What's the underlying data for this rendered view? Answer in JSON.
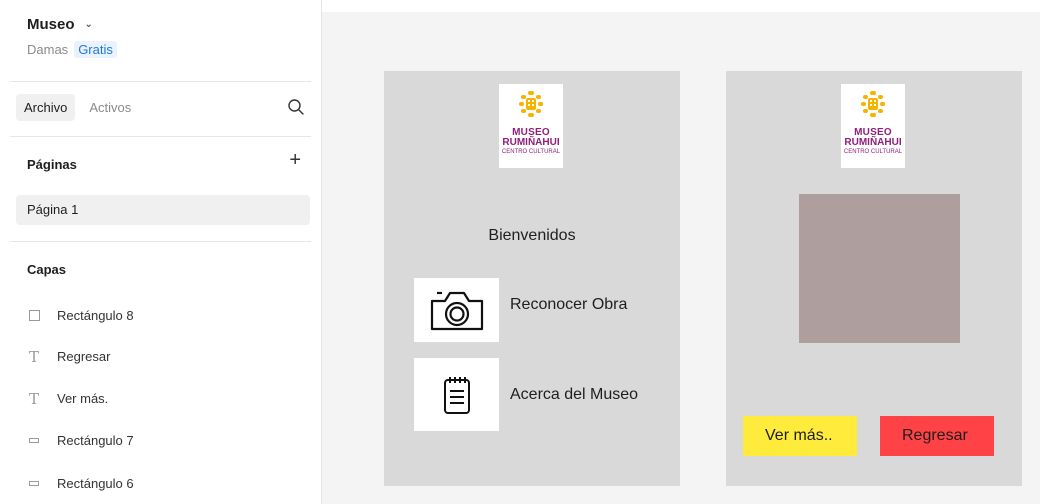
{
  "project": {
    "name": "Museo",
    "owner": "Damas",
    "plan": "Gratis"
  },
  "tabs": [
    {
      "label": "Archivo"
    },
    {
      "label": "Activos"
    }
  ],
  "pages": {
    "title": "Páginas",
    "items": [
      {
        "label": "Página 1"
      }
    ]
  },
  "layers": {
    "title": "Capas",
    "items": [
      {
        "label": "Rectángulo 8",
        "icon": "rectangle-icon"
      },
      {
        "label": "Regresar",
        "icon": "text-icon"
      },
      {
        "label": "Ver más.",
        "icon": "text-icon"
      },
      {
        "label": "Rectángulo 7",
        "icon": "rectangle-thin-icon"
      },
      {
        "label": "Rectángulo 6",
        "icon": "rectangle-thin-icon"
      }
    ]
  },
  "logo": {
    "line1": "MUSEO",
    "line2": "RUMIÑAHUI",
    "line3": "CENTRO CULTURAL"
  },
  "frame1": {
    "welcome": "Bienvenidos",
    "menu": [
      {
        "label": "Reconocer Obra",
        "icon": "camera-icon"
      },
      {
        "label": "Acerca del Museo",
        "icon": "notepad-icon"
      }
    ]
  },
  "frame2": {
    "btn_more": "Ver más..",
    "btn_back": "Regresar"
  },
  "colors": {
    "frame_bg": "#d9d9d9",
    "image_placeholder": "#ae9f9e",
    "btn_more": "#ffeb3b",
    "btn_back": "#ff4245",
    "logo_text": "#8e1f7a",
    "logo_sun": "#f4b400",
    "plan_badge": "#1d7ae0"
  }
}
